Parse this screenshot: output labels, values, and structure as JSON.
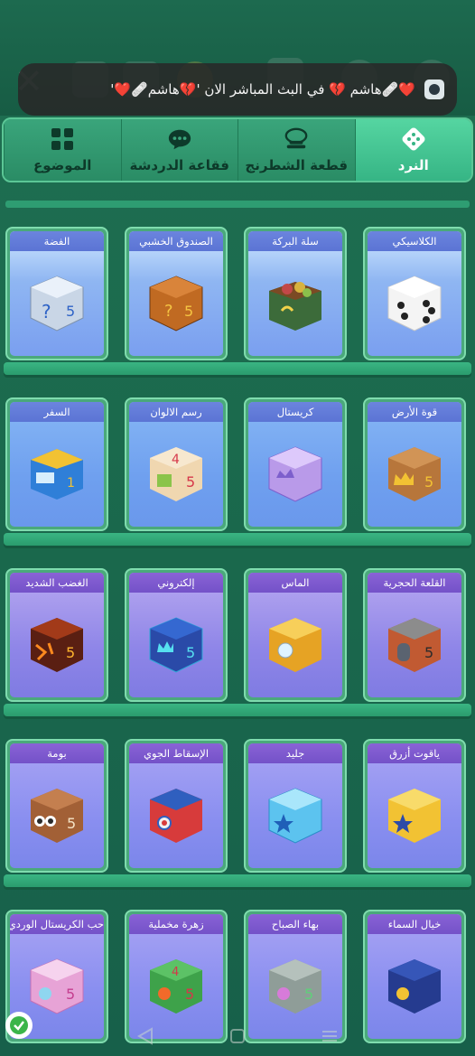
{
  "banner": {
    "text": "❤️🩹هاشم 💔 في البث المباشر الان  '💔هاشم🩹❤️'"
  },
  "tabs": [
    {
      "label": "النرد",
      "icon": "dice-icon",
      "active": true
    },
    {
      "label": "قطعة الشطرنج",
      "icon": "chess-piece-icon",
      "active": false
    },
    {
      "label": "فقاعة الدردشة",
      "icon": "chat-bubble-icon",
      "active": false
    },
    {
      "label": "الموضوع",
      "icon": "theme-grid-icon",
      "active": false
    }
  ],
  "shelves": [
    {
      "cards": [
        {
          "title": "الكلاسيكي",
          "icon": "classic-white-dice-icon",
          "color": "#f4f4f4"
        },
        {
          "title": "سلة البركة",
          "icon": "blessing-basket-icon",
          "color": "#3c6b3a"
        },
        {
          "title": "الصندوق الخشبي",
          "icon": "wooden-box-dice-icon",
          "color": "#c06a22"
        },
        {
          "title": "الفضة",
          "icon": "silver-dice-icon",
          "color": "#c9d6e6"
        }
      ]
    },
    {
      "cards": [
        {
          "title": "قوة الأرض",
          "icon": "earth-crown-dice-icon",
          "color": "#b7763b"
        },
        {
          "title": "كريستال",
          "icon": "crystal-dice-icon",
          "color": "#b99ae9"
        },
        {
          "title": "رسم الالوان",
          "icon": "painting-dice-icon",
          "color": "#f0d7b0"
        },
        {
          "title": "السفر",
          "icon": "travel-bus-dice-icon",
          "color": "#2f7fd8"
        }
      ]
    },
    {
      "cards": [
        {
          "title": "القلعة الحجرية",
          "icon": "stone-castle-dice-icon",
          "color": "#c15a32"
        },
        {
          "title": "الماس",
          "icon": "diamond-gold-dice-icon",
          "color": "#e6a324"
        },
        {
          "title": "إلكتروني",
          "icon": "electronic-dice-icon",
          "color": "#2fa8d8"
        },
        {
          "title": "الغضب الشديد",
          "icon": "lava-dice-icon",
          "color": "#a23a19"
        }
      ]
    },
    {
      "cards": [
        {
          "title": "ياقوت أزرق",
          "icon": "sapphire-star-dice-icon",
          "color": "#f2c233"
        },
        {
          "title": "جليد",
          "icon": "ice-star-dice-icon",
          "color": "#5cc3ef"
        },
        {
          "title": "الإسقاط الجوي",
          "icon": "airdrop-box-dice-icon",
          "color": "#d73b3b"
        },
        {
          "title": "بومة",
          "icon": "owl-dice-icon",
          "color": "#a26036"
        }
      ]
    },
    {
      "cards": [
        {
          "title": "خيال السماء",
          "icon": "sky-fantasy-dice-icon",
          "color": "#253b8f"
        },
        {
          "title": "بهاء الصباح",
          "icon": "morning-glory-dice-icon",
          "color": "#8f9d98"
        },
        {
          "title": "زهرة مخملية",
          "icon": "velvet-flower-dice-icon",
          "color": "#3ea24a"
        },
        {
          "title": "حب الكريستال الوردي",
          "icon": "pink-crystal-dice-icon",
          "color": "#e7a3d6"
        }
      ]
    }
  ]
}
